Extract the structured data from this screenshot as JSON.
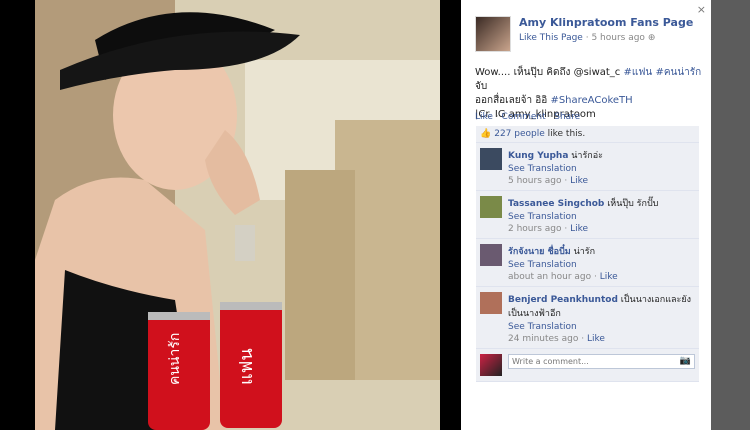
{
  "photo": {
    "can_left_label": "คนน่ารัก",
    "can_right_label": "แฟน"
  },
  "close_label": "×",
  "post": {
    "page_name": "Amy Klinpratoom Fans Page",
    "like_this_page": "Like This Page",
    "meta_sep": " · ",
    "time": "5 hours ago",
    "globe": "⊕",
    "caption_lines": [
      {
        "text": "Wow.... เห็นปุ๊บ คิดถึง  @siwat_c  ",
        "tag1": "#แฟน",
        "tag2": "#คนน่ารัก",
        "tail": " จับ"
      },
      {
        "text": "ออกสื่อเลยจ้า อิอิ ",
        "tag": "#ShareACokeTH"
      },
      {
        "text": "|Cr. IG amy_klinpratoom"
      }
    ],
    "actions": [
      "Like",
      "Comment",
      "Share"
    ],
    "actions_sep": " · "
  },
  "likes": {
    "thumb": "👍",
    "count_text": "227 people",
    "suffix": " like this."
  },
  "comments": [
    {
      "name": "Kung Yupha",
      "text": " น่ารักอ่ะ",
      "see_translation": "See Translation",
      "time": "5 hours ago",
      "like": "Like",
      "avatar_color": "#3b4a60"
    },
    {
      "name": "Tassanee Singchob",
      "text": " เห็นปุ๊บ รักปั๊บ",
      "see_translation": "See Translation",
      "time": "2 hours ago",
      "like": "Like",
      "avatar_color": "#7a8a48"
    },
    {
      "name": "รักจังนาย ชื่อบี๋ม",
      "text": " น่ารัก",
      "see_translation": "See Translation",
      "time": "about an hour ago",
      "like": "Like",
      "avatar_color": "#6a5a70"
    },
    {
      "name": "Benjerd Peankhuntod",
      "text": " เป็นนางเอกและยังเป็นนางฟ้าอีก",
      "see_translation": "See Translation",
      "time": "24 minutes ago",
      "like": "Like",
      "avatar_color": "#b0705a"
    }
  ],
  "write_comment": {
    "placeholder": "Write a comment...",
    "camera": "📷"
  },
  "colors": {
    "link": "#3b5998",
    "coke_red": "#d0101c"
  }
}
